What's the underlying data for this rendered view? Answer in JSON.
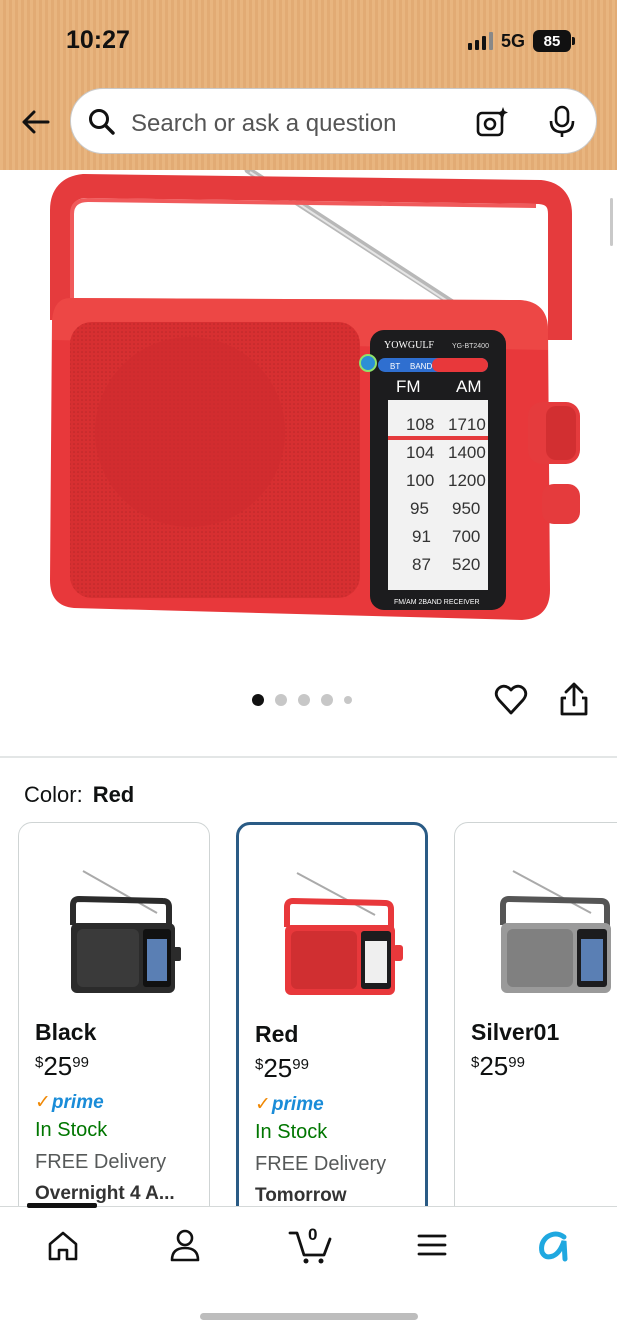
{
  "status_bar": {
    "time": "10:27",
    "network": "5G",
    "battery": "85"
  },
  "search": {
    "placeholder": "Search or ask a question"
  },
  "product_image": {
    "brand": "YOWGULF",
    "model": "YG-BT2400",
    "band_labels": [
      "BT",
      "BAND"
    ],
    "fm_label": "FM",
    "am_label": "AM",
    "fm_scale": [
      "108",
      "104",
      "100",
      "95",
      "91",
      "87"
    ],
    "am_scale": [
      "1710",
      "1400",
      "1200",
      "950",
      "700",
      "520"
    ],
    "caption": "FM/AM 2BAND RECEIVER",
    "image_count": 5,
    "active_image": 1
  },
  "color_selector": {
    "label": "Color:",
    "selected": "Red"
  },
  "variants": [
    {
      "name": "Black",
      "price_symbol": "$",
      "price_whole": "25",
      "price_cents": "99",
      "prime": "prime",
      "stock": "In Stock",
      "delivery": "FREE Delivery",
      "delivery_time": "Overnight 4 A...",
      "color": "#2b2b2b"
    },
    {
      "name": "Red",
      "price_symbol": "$",
      "price_whole": "25",
      "price_cents": "99",
      "prime": "prime",
      "stock": "In Stock",
      "delivery": "FREE Delivery",
      "delivery_time": "Tomorrow",
      "color": "#e8383b"
    },
    {
      "name": "Silver01",
      "price_symbol": "$",
      "price_whole": "25",
      "price_cents": "99",
      "color": "#8a8a8a"
    }
  ],
  "bottom_nav": {
    "cart_count": "0",
    "icons": [
      "home-icon",
      "account-icon",
      "cart-icon",
      "menu-icon",
      "rufus-icon"
    ]
  },
  "colors": {
    "accent_blue": "#2a5b85",
    "prime_blue": "#1a8cd8",
    "stock_green": "#007600",
    "header_bg": "#e8b57f"
  }
}
